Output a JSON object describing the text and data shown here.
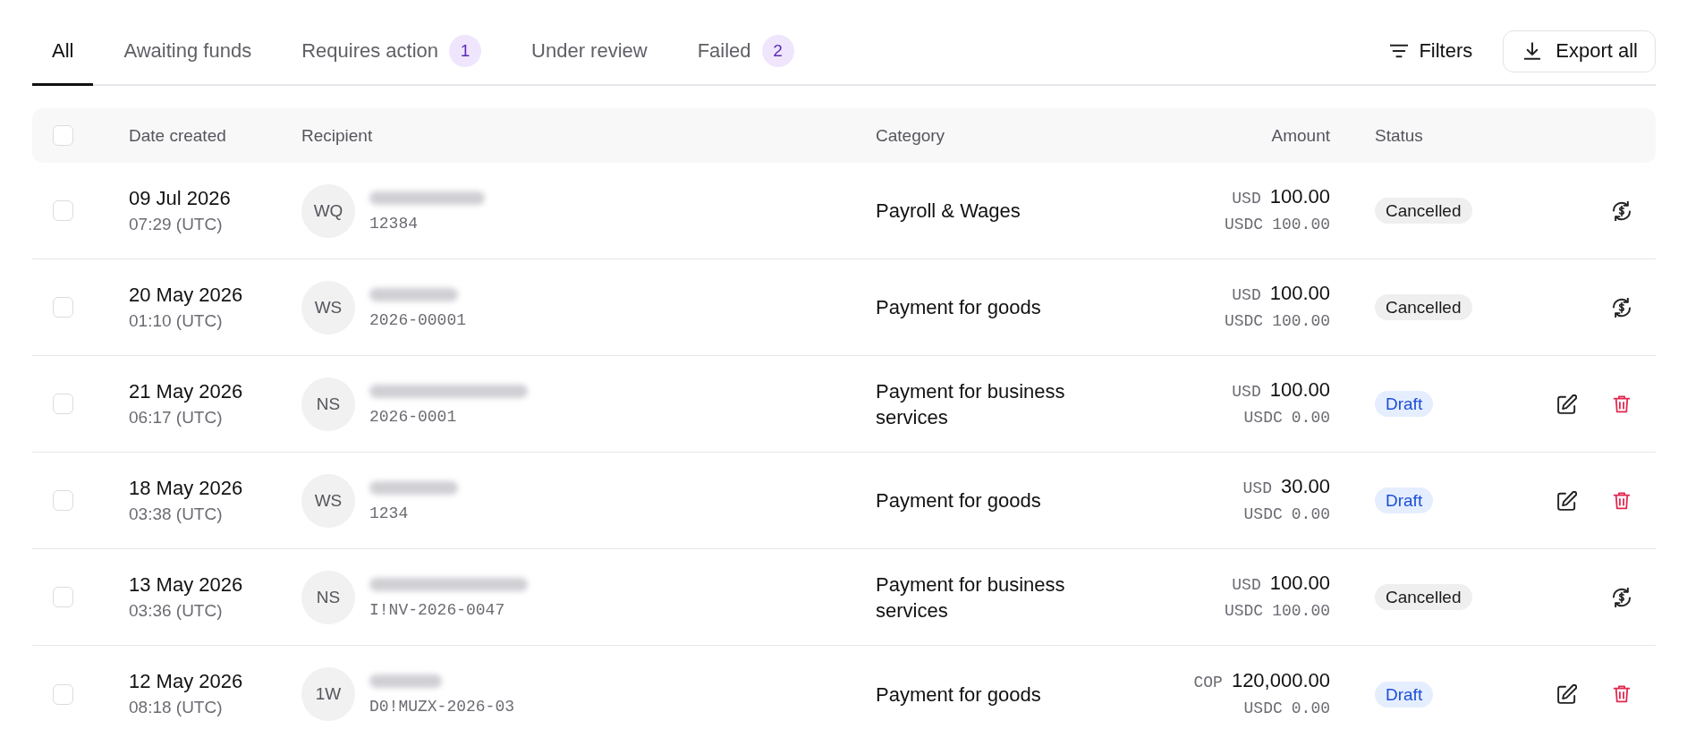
{
  "tabs": [
    {
      "label": "All",
      "selected": true
    },
    {
      "label": "Awaiting funds",
      "selected": false
    },
    {
      "label": "Requires action",
      "selected": false,
      "badge": "1"
    },
    {
      "label": "Under review",
      "selected": false
    },
    {
      "label": "Failed",
      "selected": false,
      "badge": "2"
    }
  ],
  "filters_button": {
    "label": "Filters"
  },
  "export_button": {
    "label": "Export all"
  },
  "table": {
    "select_all": {
      "checked": false
    },
    "columns": [
      "Date created",
      "Recipient",
      "Category",
      "Amount",
      "Status"
    ],
    "rows": [
      {
        "checked": false,
        "date": "09 Jul 2026",
        "time": "07:29 (UTC)",
        "initials": "WQ",
        "reference": "12384",
        "category": "Payroll & Wages",
        "amount": {
          "currency": "USD",
          "value": "100.00"
        },
        "settled": {
          "currency": "USDC",
          "value": "100.00"
        },
        "status": {
          "label": "Cancelled",
          "kind": "cancelled"
        },
        "actions": [
          {
            "kind": "dollar-cycle"
          }
        ]
      },
      {
        "checked": false,
        "date": "20 May 2026",
        "time": "01:10 (UTC)",
        "initials": "WS",
        "reference": "2026-00001",
        "category": "Payment for goods",
        "amount": {
          "currency": "USD",
          "value": "100.00"
        },
        "settled": {
          "currency": "USDC",
          "value": "100.00"
        },
        "status": {
          "label": "Cancelled",
          "kind": "cancelled"
        },
        "actions": [
          {
            "kind": "dollar-cycle"
          }
        ]
      },
      {
        "checked": false,
        "date": "21 May 2026",
        "time": "06:17 (UTC)",
        "initials": "NS",
        "reference": "2026-0001",
        "category": "Payment for business services",
        "amount": {
          "currency": "USD",
          "value": "100.00"
        },
        "settled": {
          "currency": "USDC",
          "value": "0.00"
        },
        "status": {
          "label": "Draft",
          "kind": "draft"
        },
        "actions": [
          {
            "kind": "edit"
          },
          {
            "kind": "delete"
          }
        ]
      },
      {
        "checked": false,
        "date": "18 May 2026",
        "time": "03:38 (UTC)",
        "initials": "WS",
        "reference": "1234",
        "category": "Payment for goods",
        "amount": {
          "currency": "USD",
          "value": "30.00"
        },
        "settled": {
          "currency": "USDC",
          "value": "0.00"
        },
        "status": {
          "label": "Draft",
          "kind": "draft"
        },
        "actions": [
          {
            "kind": "edit"
          },
          {
            "kind": "delete"
          }
        ]
      },
      {
        "checked": false,
        "date": "13 May 2026",
        "time": "03:36 (UTC)",
        "initials": "NS",
        "reference": "I!NV-2026-0047",
        "category": "Payment for business services",
        "amount": {
          "currency": "USD",
          "value": "100.00"
        },
        "settled": {
          "currency": "USDC",
          "value": "100.00"
        },
        "status": {
          "label": "Cancelled",
          "kind": "cancelled"
        },
        "actions": [
          {
            "kind": "dollar-cycle"
          }
        ]
      },
      {
        "checked": false,
        "date": "12 May 2026",
        "time": "08:18 (UTC)",
        "initials": "1W",
        "reference": "D0!MUZX-2026-03",
        "category": "Payment for goods",
        "amount": {
          "currency": "COP",
          "value": "120,000.00"
        },
        "settled": {
          "currency": "USDC",
          "value": "0.00"
        },
        "status": {
          "label": "Draft",
          "kind": "draft"
        },
        "actions": [
          {
            "kind": "edit"
          },
          {
            "kind": "delete"
          }
        ]
      }
    ]
  }
}
